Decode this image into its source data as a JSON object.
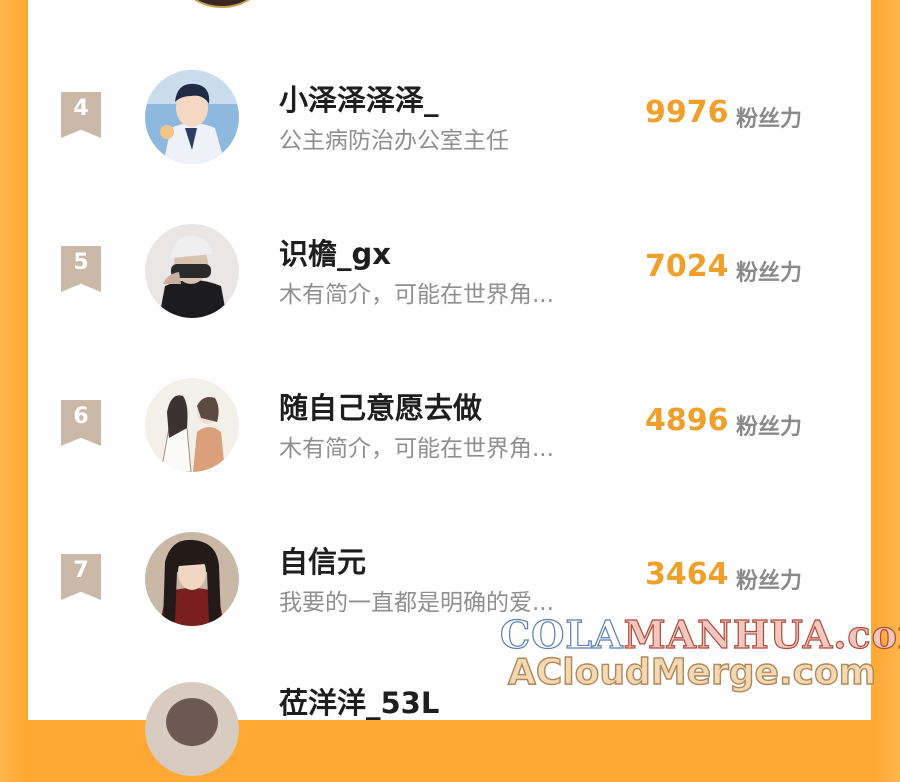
{
  "ranking": [
    {
      "rank": "4",
      "name": "小泽泽泽泽_",
      "bio": "公主病防治办公室主任",
      "score": "9976",
      "unit": "粉丝力"
    },
    {
      "rank": "5",
      "name": "识檐_gx",
      "bio": "木有简介，可能在世界角...",
      "score": "7024",
      "unit": "粉丝力"
    },
    {
      "rank": "6",
      "name": "随自己意愿去做",
      "bio": "木有简介，可能在世界角...",
      "score": "4896",
      "unit": "粉丝力"
    },
    {
      "rank": "7",
      "name": "自信元",
      "bio": "我要的一直都是明确的爱...",
      "score": "3464",
      "unit": "粉丝力"
    },
    {
      "name": "莅洋洋_53L"
    }
  ],
  "watermark": {
    "line1_a": "COLA",
    "line1_b": "MANHUA.com",
    "line2": "ACloudMerge.com"
  },
  "colors": {
    "accent": "#f0a02a",
    "background": "#ffa833",
    "rank_badge": "#cbb9a8"
  }
}
